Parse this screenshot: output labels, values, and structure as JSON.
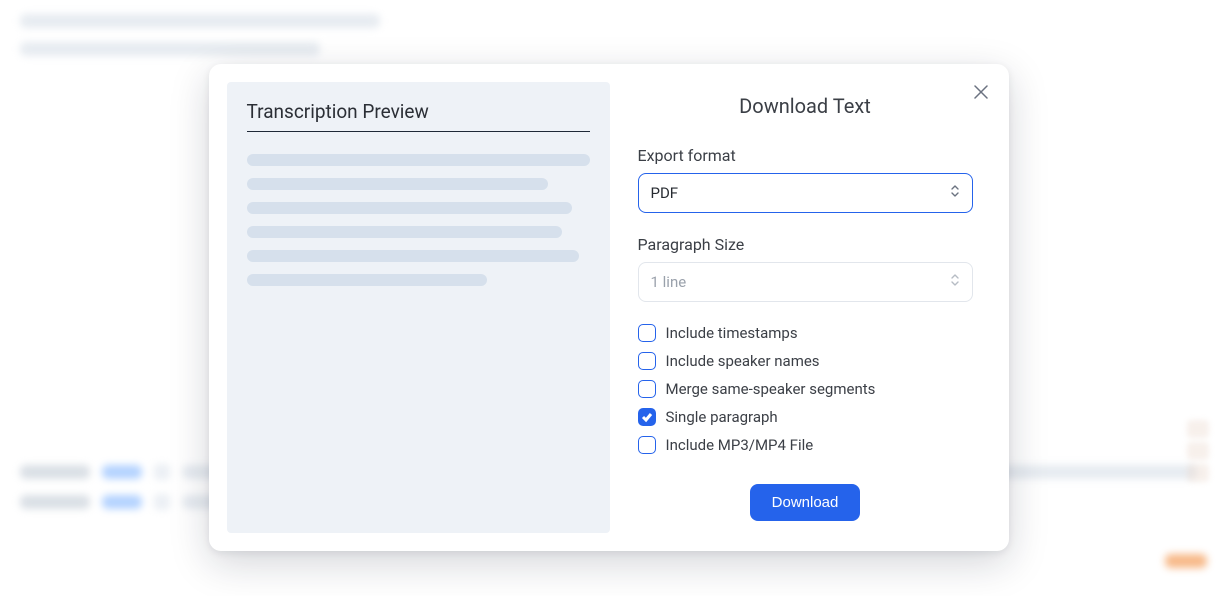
{
  "modal": {
    "preview_title": "Transcription Preview",
    "title": "Download Text",
    "export_format": {
      "label": "Export format",
      "value": "PDF"
    },
    "paragraph_size": {
      "label": "Paragraph Size",
      "value": "1 line"
    },
    "options": {
      "timestamps": {
        "label": "Include timestamps",
        "checked": false
      },
      "speakers": {
        "label": "Include speaker names",
        "checked": false
      },
      "merge": {
        "label": "Merge same-speaker segments",
        "checked": false
      },
      "single": {
        "label": "Single paragraph",
        "checked": true
      },
      "media": {
        "label": "Include MP3/MP4 File",
        "checked": false
      }
    },
    "download_label": "Download"
  }
}
